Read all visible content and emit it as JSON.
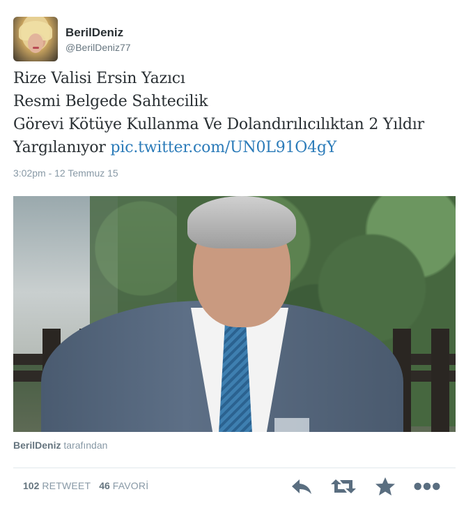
{
  "user": {
    "name": "BerilDeniz",
    "handle": "@BerilDeniz77"
  },
  "tweet": {
    "lines": [
      "Rize Valisi Ersin Yazıcı",
      "Resmi Belgede Sahtecilik",
      "Görevi Kötüye Kullanma Ve Dolandırılıcılıktan 2 Yıldır",
      "Yargılanıyor"
    ],
    "link": "pic.twitter.com/UN0L91O4gY",
    "timestamp": "3:02pm - 12 Temmuz 15"
  },
  "media": {
    "attribution_name": "BerilDeniz",
    "attribution_suffix": "tarafından"
  },
  "stats": {
    "retweets": "102",
    "retweet_label": "RETWEET",
    "favorites": "46",
    "favorite_label": "FAVORİ"
  },
  "icons": {
    "reply": "reply-icon",
    "retweet": "retweet-icon",
    "favorite": "star-icon",
    "more": "more-icon",
    "color": "#5a6e80",
    "link_color": "#2b7bb9"
  }
}
